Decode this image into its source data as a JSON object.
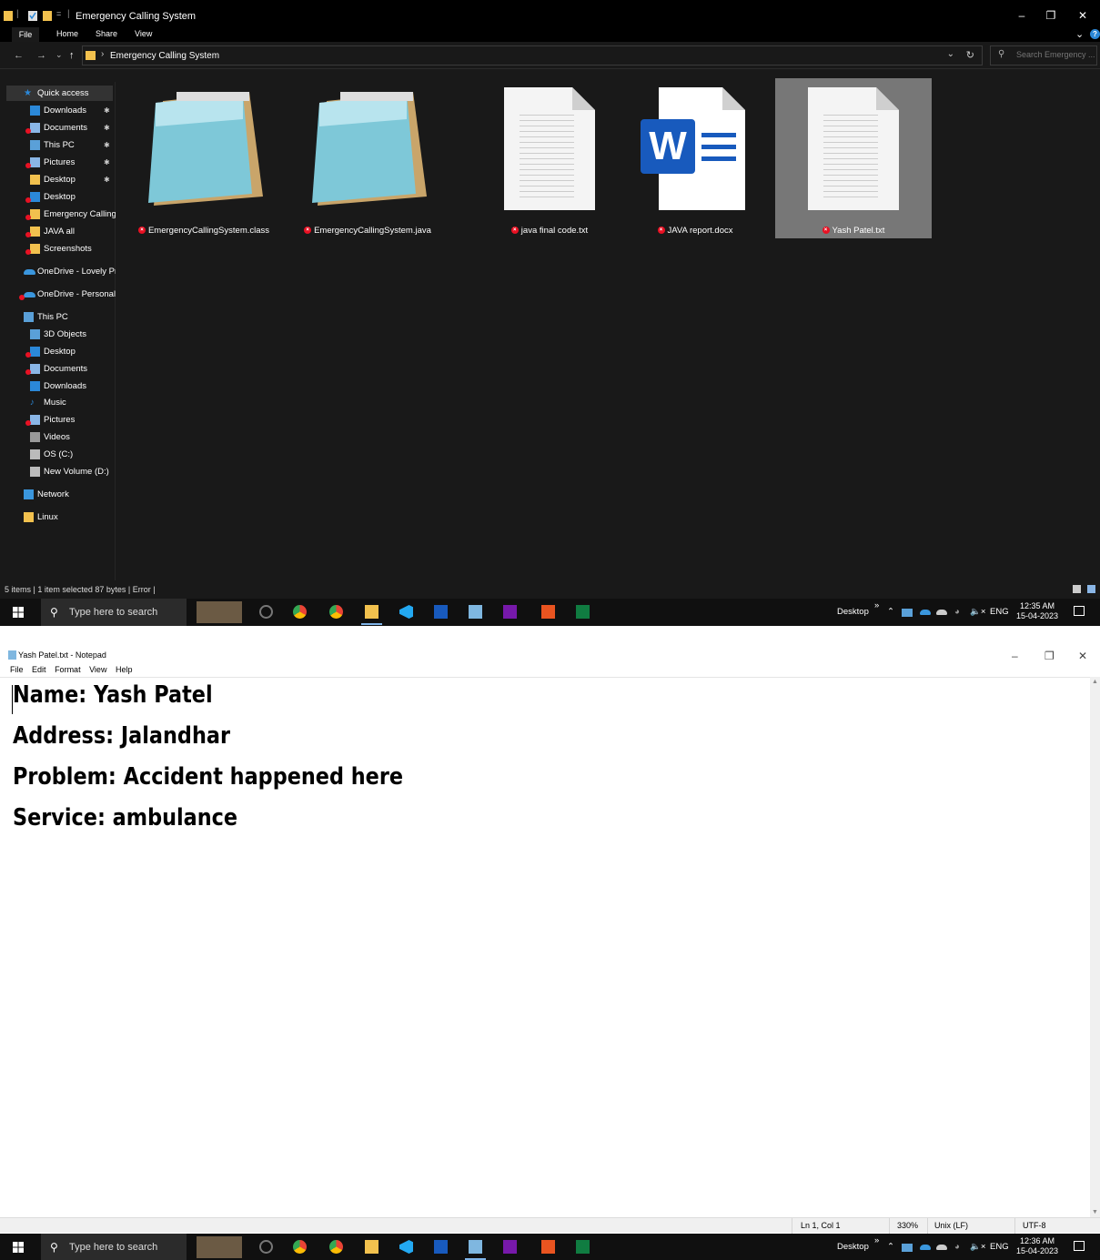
{
  "explorer": {
    "title": "Emergency Calling System",
    "ribbon_tabs": [
      "File",
      "Home",
      "Share",
      "View"
    ],
    "address_path": "Emergency Calling System",
    "search_placeholder": "Search Emergency ...",
    "nav_items": [
      {
        "label": "Quick access",
        "level": 0,
        "pinned": false,
        "error": false,
        "icon": "star-icon",
        "selected": true
      },
      {
        "label": "Downloads",
        "level": 1,
        "pinned": true,
        "error": false,
        "icon": "download-icon"
      },
      {
        "label": "Documents",
        "level": 1,
        "pinned": true,
        "error": true,
        "icon": "documents-icon"
      },
      {
        "label": "This PC",
        "level": 1,
        "pinned": true,
        "error": false,
        "icon": "computer-icon"
      },
      {
        "label": "Pictures",
        "level": 1,
        "pinned": true,
        "error": true,
        "icon": "pictures-icon"
      },
      {
        "label": "Desktop",
        "level": 1,
        "pinned": true,
        "error": false,
        "icon": "folder-icon"
      },
      {
        "label": "Desktop",
        "level": 1,
        "pinned": false,
        "error": true,
        "icon": "desktop-icon"
      },
      {
        "label": "Emergency Calling",
        "level": 1,
        "pinned": false,
        "error": true,
        "icon": "folder-icon"
      },
      {
        "label": "JAVA all",
        "level": 1,
        "pinned": false,
        "error": true,
        "icon": "folder-icon"
      },
      {
        "label": "Screenshots",
        "level": 1,
        "pinned": false,
        "error": true,
        "icon": "folder-icon"
      },
      {
        "label": "OneDrive - Lovely Pr",
        "level": 0,
        "pinned": false,
        "error": false,
        "icon": "cloud-icon"
      },
      {
        "label": "OneDrive - Personal",
        "level": 0,
        "pinned": false,
        "error": true,
        "icon": "cloud-icon"
      },
      {
        "label": "This PC",
        "level": 0,
        "pinned": false,
        "error": false,
        "icon": "computer-icon"
      },
      {
        "label": "3D Objects",
        "level": 1,
        "pinned": false,
        "error": false,
        "icon": "cube-icon"
      },
      {
        "label": "Desktop",
        "level": 1,
        "pinned": false,
        "error": true,
        "icon": "desktop-icon"
      },
      {
        "label": "Documents",
        "level": 1,
        "pinned": false,
        "error": true,
        "icon": "documents-icon"
      },
      {
        "label": "Downloads",
        "level": 1,
        "pinned": false,
        "error": false,
        "icon": "download-icon"
      },
      {
        "label": "Music",
        "level": 1,
        "pinned": false,
        "error": false,
        "icon": "music-icon"
      },
      {
        "label": "Pictures",
        "level": 1,
        "pinned": false,
        "error": true,
        "icon": "pictures-icon"
      },
      {
        "label": "Videos",
        "level": 1,
        "pinned": false,
        "error": false,
        "icon": "video-icon"
      },
      {
        "label": "OS (C:)",
        "level": 1,
        "pinned": false,
        "error": false,
        "icon": "drive-icon"
      },
      {
        "label": "New Volume (D:)",
        "level": 1,
        "pinned": false,
        "error": false,
        "icon": "drive-icon"
      },
      {
        "label": "Network",
        "level": 0,
        "pinned": false,
        "error": false,
        "icon": "network-icon"
      },
      {
        "label": "Linux",
        "level": 0,
        "pinned": false,
        "error": false,
        "icon": "linux-icon"
      }
    ],
    "files": [
      {
        "name": "EmergencyCallingSystem.class",
        "icon": "notepad-icon",
        "selected": false
      },
      {
        "name": "EmergencyCallingSystem.java",
        "icon": "notepad-icon",
        "selected": false
      },
      {
        "name": "java final code.txt",
        "icon": "text-file-icon",
        "selected": false
      },
      {
        "name": "JAVA report.docx",
        "icon": "word-doc-icon",
        "selected": false
      },
      {
        "name": "Yash Patel.txt",
        "icon": "text-file-icon",
        "selected": true
      }
    ],
    "status_text": "5 items  |  1 item selected  87 bytes  |  Error  |"
  },
  "taskbar": {
    "search_placeholder": "Type here to search",
    "tray_label": "Desktop",
    "chevron": "»",
    "language": "ENG",
    "explorer_time": "12:35 AM",
    "notepad_time": "12:36 AM",
    "date": "15-04-2023"
  },
  "notepad": {
    "title": "Yash Patel.txt - Notepad",
    "menu": [
      "File",
      "Edit",
      "Format",
      "View",
      "Help"
    ],
    "lines": [
      "Name: Yash Patel",
      "Address: Jalandhar",
      "Problem: Accident happened here",
      "Service: ambulance"
    ],
    "status": {
      "position": "Ln 1, Col 1",
      "zoom": "330%",
      "line_ending": "Unix (LF)",
      "encoding": "UTF-8"
    }
  },
  "colors": {
    "explorer_bg": "#191919",
    "error_red": "#e81123",
    "accent_blue": "#2b88d8",
    "word_blue": "#185abd",
    "folder_yellow": "#f2c14e"
  }
}
